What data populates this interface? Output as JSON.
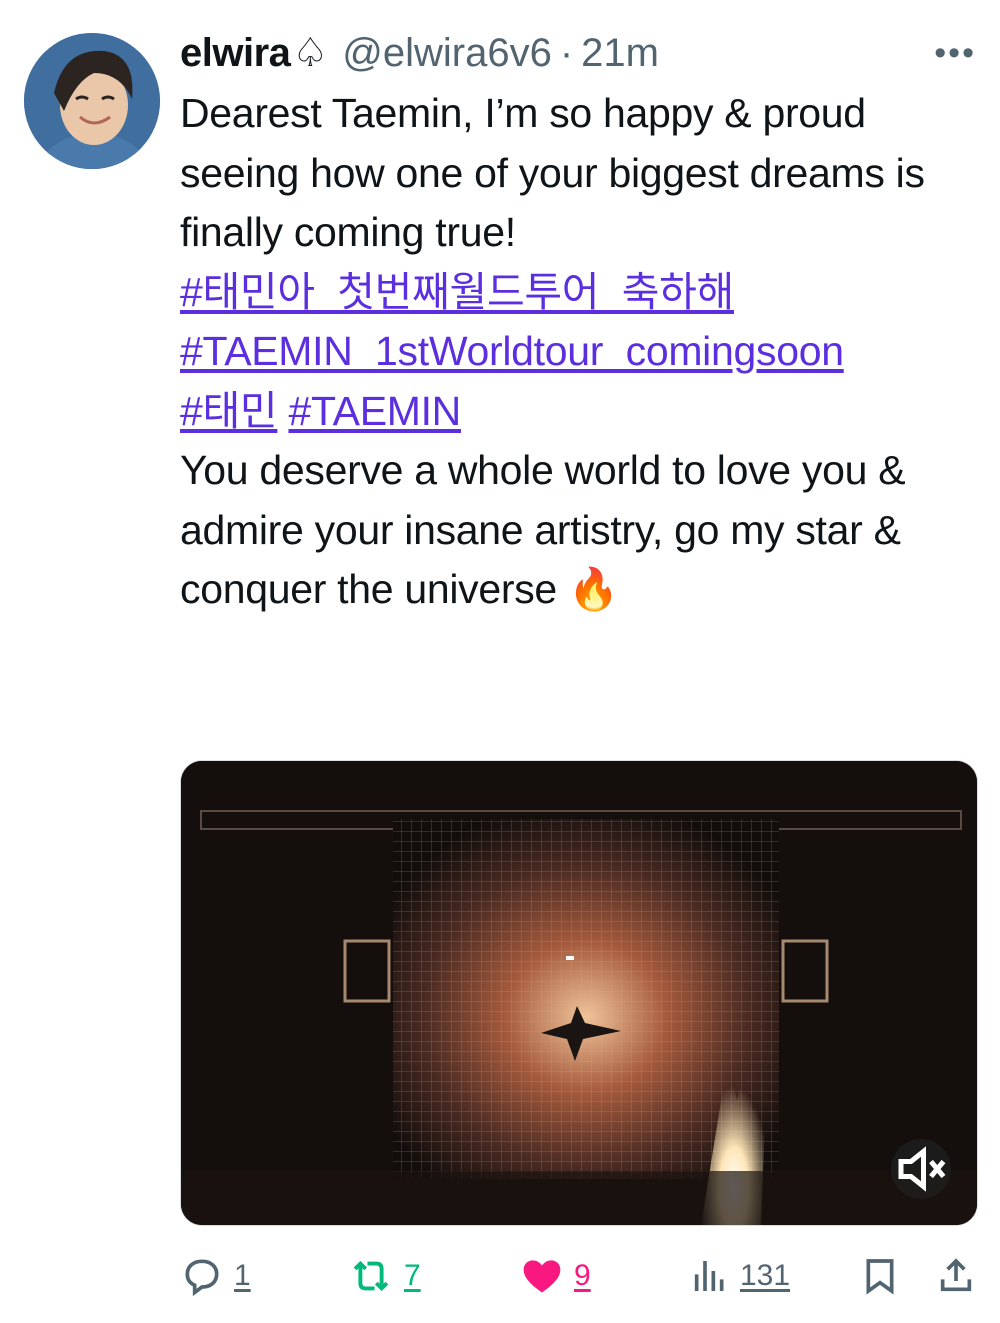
{
  "tweet": {
    "display_name": "elwira",
    "name_symbol": "♤",
    "handle": "@elwira6v6",
    "separator": "·",
    "time": "21m",
    "more_icon": "more-horizontal-icon",
    "text_intro": "Dearest Taemin, I’m so happy & proud seeing how one of your biggest dreams is finally coming true!",
    "hashtags": [
      "#태민아_첫번째월드투어_축하해",
      "#TAEMIN_1stWorldtour_comingsoon",
      "#태민",
      "#TAEMIN"
    ],
    "text_outro": "You deserve a whole world to love you & admire your insane artistry, go my star & conquer the universe 🔥"
  },
  "media": {
    "type": "video",
    "mute_icon": "volume-muted-icon"
  },
  "actions": {
    "replies": "1",
    "reposts": "7",
    "likes": "9",
    "views": "131",
    "reply_icon": "reply-icon",
    "repost_icon": "repost-icon",
    "like_icon": "heart-icon",
    "views_icon": "views-chart-icon",
    "bookmark_icon": "bookmark-icon",
    "share_icon": "share-icon"
  },
  "colors": {
    "hashtag": "#5b2fe0",
    "repost": "#00ba7c",
    "like": "#f91880",
    "muted_text": "#536471"
  }
}
